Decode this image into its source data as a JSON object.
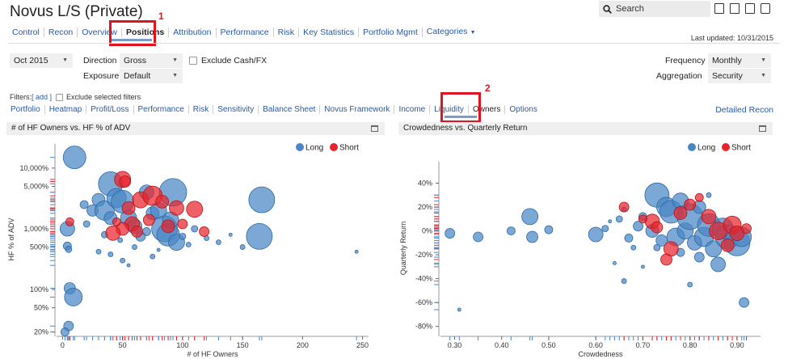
{
  "header": {
    "title": "Novus L/S (Private)",
    "search_label": "Search",
    "last_updated": "Last updated: 10/31/2015"
  },
  "main_nav": [
    {
      "label": "Control"
    },
    {
      "label": "Recon"
    },
    {
      "label": "Overview"
    },
    {
      "label": "Positions",
      "active": true
    },
    {
      "label": "Attribution"
    },
    {
      "label": "Performance"
    },
    {
      "label": "Risk"
    },
    {
      "label": "Key Statistics"
    },
    {
      "label": "Portfolio Mgmt"
    },
    {
      "label": "Categories",
      "dropdown": true
    }
  ],
  "annotations": {
    "marker1": "1",
    "marker2": "2"
  },
  "controls": {
    "period": "Oct 2015",
    "direction_label": "Direction",
    "direction_value": "Gross",
    "exposure_label": "Exposure",
    "exposure_value": "Default",
    "exclude_cash_label": "Exclude Cash/FX",
    "frequency_label": "Frequency",
    "frequency_value": "Monthly",
    "aggregation_label": "Aggregation",
    "aggregation_value": "Security"
  },
  "filters": {
    "label": "Filters",
    "add_link": "[ add ]",
    "exclude_selected_label": "Exclude selected filters"
  },
  "sub_nav": [
    {
      "label": "Portfolio"
    },
    {
      "label": "Heatmap"
    },
    {
      "label": "Profit/Loss"
    },
    {
      "label": "Performance"
    },
    {
      "label": "Risk"
    },
    {
      "label": "Sensitivity"
    },
    {
      "label": "Balance Sheet"
    },
    {
      "label": "Novus Framework"
    },
    {
      "label": "Income"
    },
    {
      "label": "Liquidity"
    },
    {
      "label": "Owners",
      "active": true
    },
    {
      "label": "Options"
    }
  ],
  "detailed_recon": "Detailed Recon",
  "colors": {
    "long": "#4a86c5",
    "short": "#e8242b",
    "accent": "#2a5aa0",
    "annotation": "#e0141e"
  },
  "chart_data": [
    {
      "type": "scatter",
      "title": "# of HF Owners vs. HF % of ADV",
      "xlabel": "# of HF Owners",
      "ylabel": "HF % of ADV",
      "y_scale": "log",
      "xlim": [
        -5,
        255
      ],
      "ylim": [
        18,
        25000
      ],
      "x_ticks": [
        0,
        50,
        100,
        150,
        200,
        250
      ],
      "y_ticks": [
        {
          "value": 10000,
          "label": "10,000%"
        },
        {
          "value": 5000,
          "label": "5,000%"
        },
        {
          "value": 1000,
          "label": "1,000%"
        },
        {
          "value": 500,
          "label": "500%"
        },
        {
          "value": 100,
          "label": "100%"
        },
        {
          "value": 50,
          "label": "50%"
        },
        {
          "value": 20,
          "label": "20%"
        }
      ],
      "legend": "top-right",
      "series": [
        {
          "name": "Long",
          "points": [
            {
              "x": 10,
              "y": 15000,
              "s": 14
            },
            {
              "x": 4,
              "y": 1000,
              "s": 9
            },
            {
              "x": 4,
              "y": 520,
              "s": 5
            },
            {
              "x": 5,
              "y": 460,
              "s": 4
            },
            {
              "x": 6,
              "y": 105,
              "s": 7
            },
            {
              "x": 9,
              "y": 75,
              "s": 11
            },
            {
              "x": 5,
              "y": 25,
              "s": 6
            },
            {
              "x": 2,
              "y": 20,
              "s": 5
            },
            {
              "x": 18,
              "y": 2500,
              "s": 5
            },
            {
              "x": 25,
              "y": 2000,
              "s": 7
            },
            {
              "x": 30,
              "y": 3000,
              "s": 8
            },
            {
              "x": 35,
              "y": 2000,
              "s": 12
            },
            {
              "x": 40,
              "y": 5500,
              "s": 15
            },
            {
              "x": 45,
              "y": 3200,
              "s": 12
            },
            {
              "x": 50,
              "y": 2800,
              "s": 14
            },
            {
              "x": 55,
              "y": 1500,
              "s": 10
            },
            {
              "x": 60,
              "y": 1100,
              "s": 9
            },
            {
              "x": 40,
              "y": 1500,
              "s": 8
            },
            {
              "x": 70,
              "y": 4000,
              "s": 9
            },
            {
              "x": 75,
              "y": 1800,
              "s": 8
            },
            {
              "x": 80,
              "y": 2000,
              "s": 10
            },
            {
              "x": 85,
              "y": 1000,
              "s": 16
            },
            {
              "x": 88,
              "y": 800,
              "s": 14
            },
            {
              "x": 90,
              "y": 1400,
              "s": 10
            },
            {
              "x": 95,
              "y": 600,
              "s": 10
            },
            {
              "x": 92,
              "y": 4000,
              "s": 17
            },
            {
              "x": 65,
              "y": 750,
              "s": 6
            },
            {
              "x": 70,
              "y": 900,
              "s": 5
            },
            {
              "x": 100,
              "y": 750,
              "s": 4
            },
            {
              "x": 110,
              "y": 1000,
              "s": 4
            },
            {
              "x": 120,
              "y": 700,
              "s": 3
            },
            {
              "x": 130,
              "y": 600,
              "s": 3
            },
            {
              "x": 150,
              "y": 500,
              "s": 3
            },
            {
              "x": 166,
              "y": 3000,
              "s": 16
            },
            {
              "x": 164,
              "y": 750,
              "s": 16
            },
            {
              "x": 245,
              "y": 420,
              "s": 2
            },
            {
              "x": 30,
              "y": 420,
              "s": 3
            },
            {
              "x": 40,
              "y": 380,
              "s": 3
            },
            {
              "x": 50,
              "y": 300,
              "s": 3
            },
            {
              "x": 60,
              "y": 500,
              "s": 3
            },
            {
              "x": 75,
              "y": 350,
              "s": 3
            },
            {
              "x": 35,
              "y": 800,
              "s": 4
            },
            {
              "x": 20,
              "y": 1200,
              "s": 4
            },
            {
              "x": 140,
              "y": 800,
              "s": 2
            },
            {
              "x": 105,
              "y": 550,
              "s": 3
            },
            {
              "x": 80,
              "y": 450,
              "s": 2
            },
            {
              "x": 48,
              "y": 650,
              "s": 3
            },
            {
              "x": 55,
              "y": 250,
              "s": 2
            }
          ]
        },
        {
          "name": "Short",
          "points": [
            {
              "x": 50,
              "y": 6500,
              "s": 10
            },
            {
              "x": 52,
              "y": 6000,
              "s": 7
            },
            {
              "x": 55,
              "y": 2200,
              "s": 8
            },
            {
              "x": 65,
              "y": 3000,
              "s": 10
            },
            {
              "x": 75,
              "y": 3500,
              "s": 12
            },
            {
              "x": 58,
              "y": 1200,
              "s": 9
            },
            {
              "x": 50,
              "y": 1000,
              "s": 8
            },
            {
              "x": 42,
              "y": 850,
              "s": 9
            },
            {
              "x": 62,
              "y": 900,
              "s": 7
            },
            {
              "x": 72,
              "y": 1400,
              "s": 7
            },
            {
              "x": 95,
              "y": 2200,
              "s": 9
            },
            {
              "x": 110,
              "y": 2100,
              "s": 10
            },
            {
              "x": 118,
              "y": 900,
              "s": 6
            },
            {
              "x": 88,
              "y": 1100,
              "s": 8
            },
            {
              "x": 100,
              "y": 1200,
              "s": 6
            },
            {
              "x": 6,
              "y": 1300,
              "s": 5
            },
            {
              "x": 45,
              "y": 1300,
              "s": 5
            },
            {
              "x": 83,
              "y": 2800,
              "s": 8
            }
          ]
        }
      ]
    },
    {
      "type": "scatter",
      "title": "Crowdedness vs. Quarterly Return",
      "xlabel": "Crowdedness",
      "ylabel": "Quarterly Return",
      "xlim": [
        0.27,
        0.95
      ],
      "ylim": [
        -0.87,
        0.58
      ],
      "x_ticks": [
        0.3,
        0.4,
        0.5,
        0.6,
        0.7,
        0.8,
        0.9
      ],
      "x_tick_labels": [
        "0.30",
        "0.40",
        "0.50",
        "0.60",
        "0.70",
        "0.80",
        "0.90"
      ],
      "y_ticks": [
        0.4,
        0.2,
        0,
        -0.2,
        -0.4,
        -0.6,
        -0.8
      ],
      "y_tick_labels": [
        "40%",
        "20%",
        "0%",
        "-20%",
        "-40%",
        "-60%",
        "-80%"
      ],
      "legend": "top-right",
      "series": [
        {
          "name": "Long",
          "points": [
            {
              "x": 0.29,
              "y": -0.02,
              "s": 6
            },
            {
              "x": 0.31,
              "y": -0.66,
              "s": 2
            },
            {
              "x": 0.35,
              "y": -0.05,
              "s": 6
            },
            {
              "x": 0.42,
              "y": 0.0,
              "s": 5
            },
            {
              "x": 0.46,
              "y": 0.12,
              "s": 10
            },
            {
              "x": 0.465,
              "y": -0.05,
              "s": 7
            },
            {
              "x": 0.5,
              "y": 0.01,
              "s": 5
            },
            {
              "x": 0.6,
              "y": -0.03,
              "s": 9
            },
            {
              "x": 0.62,
              "y": 0.02,
              "s": 4
            },
            {
              "x": 0.65,
              "y": 0.1,
              "s": 4
            },
            {
              "x": 0.66,
              "y": 0.18,
              "s": 3
            },
            {
              "x": 0.67,
              "y": -0.06,
              "s": 5
            },
            {
              "x": 0.68,
              "y": -0.14,
              "s": 3
            },
            {
              "x": 0.69,
              "y": 0.04,
              "s": 6
            },
            {
              "x": 0.7,
              "y": 0.12,
              "s": 5
            },
            {
              "x": 0.72,
              "y": 0.0,
              "s": 8
            },
            {
              "x": 0.73,
              "y": 0.3,
              "s": 15
            },
            {
              "x": 0.74,
              "y": -0.08,
              "s": 7
            },
            {
              "x": 0.75,
              "y": 0.2,
              "s": 12
            },
            {
              "x": 0.76,
              "y": 0.16,
              "s": 14
            },
            {
              "x": 0.77,
              "y": -0.05,
              "s": 11
            },
            {
              "x": 0.78,
              "y": 0.25,
              "s": 10
            },
            {
              "x": 0.79,
              "y": 0.0,
              "s": 10
            },
            {
              "x": 0.8,
              "y": 0.12,
              "s": 16
            },
            {
              "x": 0.81,
              "y": -0.1,
              "s": 9
            },
            {
              "x": 0.82,
              "y": 0.2,
              "s": 8
            },
            {
              "x": 0.83,
              "y": -0.05,
              "s": 12
            },
            {
              "x": 0.84,
              "y": 0.05,
              "s": 14
            },
            {
              "x": 0.85,
              "y": -0.15,
              "s": 10
            },
            {
              "x": 0.86,
              "y": -0.28,
              "s": 9
            },
            {
              "x": 0.87,
              "y": 0.02,
              "s": 13
            },
            {
              "x": 0.88,
              "y": -0.05,
              "s": 15
            },
            {
              "x": 0.9,
              "y": -0.1,
              "s": 16
            },
            {
              "x": 0.91,
              "y": -0.05,
              "s": 12
            },
            {
              "x": 0.915,
              "y": -0.6,
              "s": 6
            },
            {
              "x": 0.8,
              "y": -0.45,
              "s": 3
            },
            {
              "x": 0.7,
              "y": -0.3,
              "s": 2
            },
            {
              "x": 0.66,
              "y": -0.42,
              "s": 3
            },
            {
              "x": 0.64,
              "y": -0.27,
              "s": 2
            },
            {
              "x": 0.63,
              "y": 0.08,
              "s": 2
            },
            {
              "x": 0.84,
              "y": 0.3,
              "s": 3
            },
            {
              "x": 0.73,
              "y": -0.14,
              "s": 4
            },
            {
              "x": 0.78,
              "y": -0.18,
              "s": 5
            },
            {
              "x": 0.82,
              "y": -0.22,
              "s": 6
            }
          ]
        },
        {
          "name": "Short",
          "points": [
            {
              "x": 0.66,
              "y": 0.2,
              "s": 6
            },
            {
              "x": 0.72,
              "y": 0.08,
              "s": 9
            },
            {
              "x": 0.76,
              "y": -0.15,
              "s": 9
            },
            {
              "x": 0.75,
              "y": -0.24,
              "s": 7
            },
            {
              "x": 0.8,
              "y": 0.22,
              "s": 7
            },
            {
              "x": 0.82,
              "y": 0.28,
              "s": 5
            },
            {
              "x": 0.84,
              "y": 0.12,
              "s": 9
            },
            {
              "x": 0.86,
              "y": 0.0,
              "s": 11
            },
            {
              "x": 0.89,
              "y": 0.05,
              "s": 11
            },
            {
              "x": 0.9,
              "y": -0.02,
              "s": 9
            },
            {
              "x": 0.88,
              "y": -0.12,
              "s": 8
            },
            {
              "x": 0.92,
              "y": 0.02,
              "s": 6
            },
            {
              "x": 0.73,
              "y": 0.03,
              "s": 7
            },
            {
              "x": 0.7,
              "y": 0.1,
              "s": 5
            },
            {
              "x": 0.78,
              "y": 0.15,
              "s": 8
            }
          ]
        }
      ]
    }
  ]
}
